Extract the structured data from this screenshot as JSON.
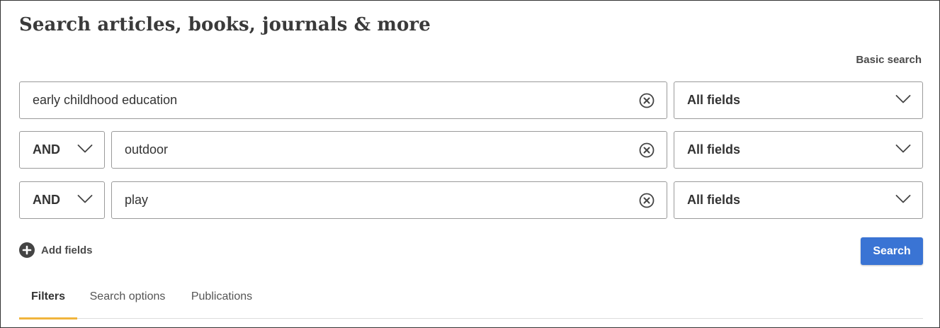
{
  "header": {
    "title": "Search articles, books, journals & more",
    "basic_search_link": "Basic search"
  },
  "rows": [
    {
      "operator": null,
      "query": "early childhood education",
      "field": "All fields"
    },
    {
      "operator": "AND",
      "query": "outdoor",
      "field": "All fields"
    },
    {
      "operator": "AND",
      "query": "play",
      "field": "All fields"
    }
  ],
  "actions": {
    "add_fields_label": "Add fields",
    "search_label": "Search"
  },
  "tabs": [
    {
      "label": "Filters",
      "active": true
    },
    {
      "label": "Search options",
      "active": false
    },
    {
      "label": "Publications",
      "active": false
    }
  ],
  "colors": {
    "primary_button": "#3a74d4",
    "active_tab_underline": "#f0b43c",
    "text": "#333333"
  },
  "icons": {
    "clear": "clear-circle-x-icon",
    "dropdown": "chevron-down-icon",
    "add": "plus-circle-icon"
  }
}
